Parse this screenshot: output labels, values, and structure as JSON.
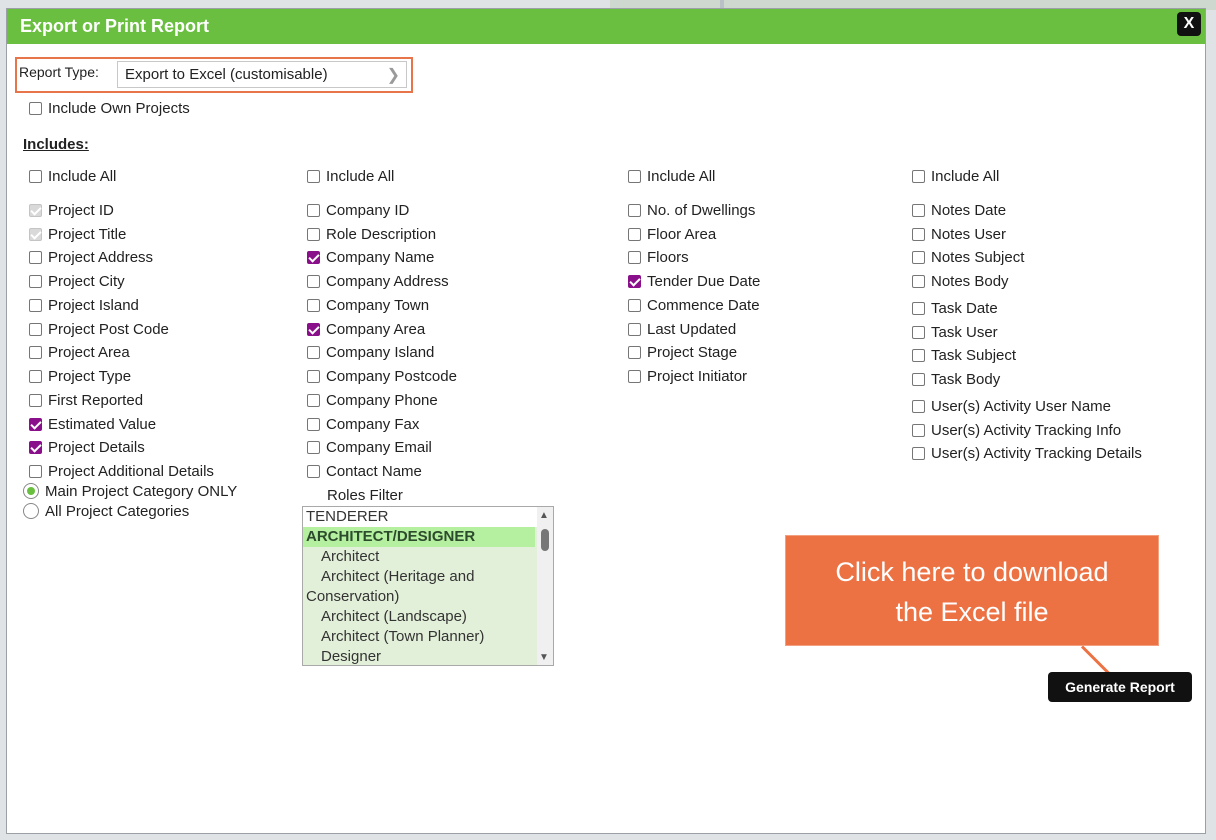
{
  "dialog": {
    "title": "Export or Print Report",
    "close_label": "X"
  },
  "report_type": {
    "label": "Report Type:",
    "value": "Export to Excel (customisable)"
  },
  "include_own_projects": "Include Own Projects",
  "includes_heading": "Includes:",
  "columns": [
    {
      "include_all": "Include All",
      "items": [
        {
          "label": "Project ID",
          "state": "disabled"
        },
        {
          "label": "Project Title",
          "state": "disabled"
        },
        {
          "label": "Project Address",
          "state": "off"
        },
        {
          "label": "Project City",
          "state": "off"
        },
        {
          "label": "Project Island",
          "state": "off"
        },
        {
          "label": "Project Post Code",
          "state": "off"
        },
        {
          "label": "Project Area",
          "state": "off"
        },
        {
          "label": "Project Type",
          "state": "off"
        },
        {
          "label": "First Reported",
          "state": "off"
        },
        {
          "label": "Estimated Value",
          "state": "on"
        },
        {
          "label": "Project Details",
          "state": "on"
        },
        {
          "label": "Project Additional Details",
          "state": "off"
        }
      ]
    },
    {
      "include_all": "Include All",
      "items": [
        {
          "label": "Company ID",
          "state": "off"
        },
        {
          "label": "Role Description",
          "state": "off"
        },
        {
          "label": "Company Name",
          "state": "on"
        },
        {
          "label": "Company Address",
          "state": "off"
        },
        {
          "label": "Company Town",
          "state": "off"
        },
        {
          "label": "Company Area",
          "state": "on"
        },
        {
          "label": "Company Island",
          "state": "off"
        },
        {
          "label": "Company Postcode",
          "state": "off"
        },
        {
          "label": "Company Phone",
          "state": "off"
        },
        {
          "label": "Company Fax",
          "state": "off"
        },
        {
          "label": "Company Email",
          "state": "off"
        },
        {
          "label": "Contact Name",
          "state": "off"
        }
      ]
    },
    {
      "include_all": "Include All",
      "items": [
        {
          "label": "No. of Dwellings",
          "state": "off"
        },
        {
          "label": "Floor Area",
          "state": "off"
        },
        {
          "label": "Floors",
          "state": "off"
        },
        {
          "label": "Tender Due Date",
          "state": "on"
        },
        {
          "label": "Commence Date",
          "state": "off"
        },
        {
          "label": "Last Updated",
          "state": "off"
        },
        {
          "label": "Project Stage",
          "state": "off"
        },
        {
          "label": "Project Initiator",
          "state": "off"
        }
      ]
    },
    {
      "include_all": "Include All",
      "items": [
        {
          "label": "Notes Date",
          "state": "off"
        },
        {
          "label": "Notes User",
          "state": "off"
        },
        {
          "label": "Notes Subject",
          "state": "off"
        },
        {
          "label": "Notes Body",
          "state": "off"
        },
        {
          "label": "Task Date",
          "state": "off"
        },
        {
          "label": "Task User",
          "state": "off"
        },
        {
          "label": "Task Subject",
          "state": "off"
        },
        {
          "label": "Task Body",
          "state": "off"
        },
        {
          "label": "User(s) Activity User Name",
          "state": "off"
        },
        {
          "label": "User(s) Activity Tracking Info",
          "state": "off"
        },
        {
          "label": "User(s) Activity Tracking Details",
          "state": "off"
        }
      ]
    }
  ],
  "category_options": [
    {
      "label": "Main Project Category ONLY",
      "selected": true
    },
    {
      "label": "All Project Categories",
      "selected": false
    }
  ],
  "roles_filter": {
    "label": "Roles Filter",
    "items": [
      {
        "label": "TENDERER",
        "kind": "header"
      },
      {
        "label": "ARCHITECT/DESIGNER",
        "kind": "selected"
      },
      {
        "label": "Architect",
        "kind": "sub"
      },
      {
        "label": "Architect (Heritage and Conservation)",
        "kind": "wrap"
      },
      {
        "label": "Architect (Landscape)",
        "kind": "sub"
      },
      {
        "label": "Architect (Town Planner)",
        "kind": "sub"
      },
      {
        "label": "Designer",
        "kind": "sub"
      }
    ]
  },
  "callout": {
    "line1": "Click here to download",
    "line2": "the Excel file"
  },
  "generate_button": "Generate Report",
  "colors": {
    "titlebar": "#6abf40",
    "callout": "#ec7244",
    "checked": "#8a0f8a",
    "highlight_border": "#e8744a"
  }
}
